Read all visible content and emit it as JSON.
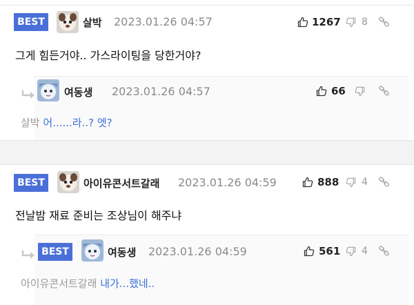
{
  "comments": [
    {
      "badge": "BEST",
      "nickname": "살박",
      "date": "2023.01.26 04:57",
      "likes": "1267",
      "dislikes": "8",
      "text": "그게 힘든거야.. 가스라이팅을 당한거야?",
      "reply": {
        "nickname": "여동생",
        "date": "2023.01.26 04:57",
        "likes": "66",
        "mention": "살박",
        "text": "어......라..? 엣?"
      }
    },
    {
      "badge": "BEST",
      "nickname": "아이유콘서트갈래",
      "date": "2023.01.26 04:59",
      "likes": "888",
      "dislikes": "4",
      "text": "전날밤 재료 준비는 조상님이 해주냐",
      "reply": {
        "badge": "BEST",
        "nickname": "여동생",
        "date": "2023.01.26 04:59",
        "likes": "561",
        "dislikes": "4",
        "mention": "아이유콘서트갈래",
        "text": "내가...했네.."
      }
    }
  ],
  "colors": {
    "best_badge": "#4a6fd8",
    "reply_text": "#3a6fd8",
    "muted": "#8a8a8a"
  },
  "icons": {
    "like": "thumbs-up-icon",
    "dislike": "thumbs-down-icon",
    "link": "link-icon",
    "reply_arrow": "reply-arrow-icon"
  }
}
